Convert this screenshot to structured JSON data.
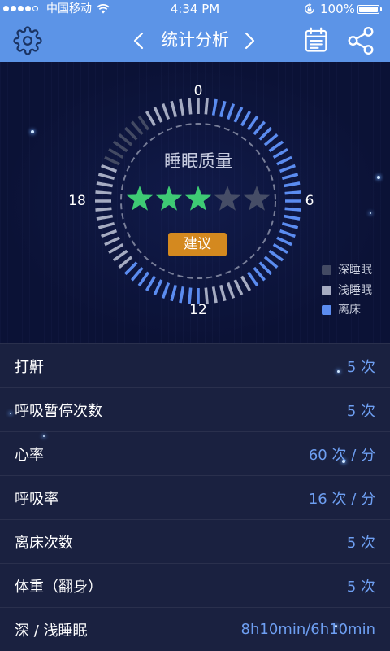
{
  "status_bar": {
    "signal_strength": 4,
    "signal_max": 5,
    "carrier": "中国移动",
    "wifi_icon": "wifi-icon",
    "time": "4:34 PM",
    "orientation_lock_icon": "orientation-lock-icon",
    "battery_text": "100%",
    "battery_level": 1.0
  },
  "header": {
    "title": "统计分析",
    "settings_icon": "gear-icon",
    "prev_icon": "chevron-left-icon",
    "next_icon": "chevron-right-icon",
    "calendar_icon": "calendar-icon",
    "share_icon": "share-icon"
  },
  "dial": {
    "hour_labels": {
      "top": "0",
      "right": "6",
      "bottom": "12",
      "left": "18"
    },
    "title": "睡眠质量",
    "rating": 3,
    "rating_max": 5,
    "advice_button": "建议",
    "stage_ticks": [
      {
        "stage": "light",
        "ticks": 2
      },
      {
        "stage": "away",
        "ticks": 28
      },
      {
        "stage": "light",
        "ticks": 6
      },
      {
        "stage": "away",
        "ticks": 10
      },
      {
        "stage": "light",
        "ticks": 13
      },
      {
        "stage": "deep",
        "ticks": 7
      },
      {
        "stage": "light",
        "ticks": 6
      }
    ]
  },
  "legend": [
    {
      "stage": "deep",
      "label": "深睡眠",
      "color": "#434a63"
    },
    {
      "stage": "light",
      "label": "浅睡眠",
      "color": "#a6acc2"
    },
    {
      "stage": "away",
      "label": "离床",
      "color": "#5b8cf0"
    }
  ],
  "colors": {
    "header": "#5c94e7",
    "background": "#0b1236",
    "list_row": "#1a2140",
    "value_text": "#6e9ff2",
    "star_filled": "#3ecb74",
    "star_empty": "#464d66",
    "advice_button": "#d4891f",
    "gear_icon": "#1b3463"
  },
  "stats": [
    {
      "label": "打鼾",
      "value": "5 次"
    },
    {
      "label": "呼吸暂停次数",
      "value": "5 次"
    },
    {
      "label": "心率",
      "value": "60 次 / 分"
    },
    {
      "label": "呼吸率",
      "value": "16 次 / 分"
    },
    {
      "label": "离床次数",
      "value": "5 次"
    },
    {
      "label": "体重（翻身）",
      "value": "5 次"
    },
    {
      "label": "深 / 浅睡眠",
      "value": "8h10min/6h10min"
    }
  ]
}
